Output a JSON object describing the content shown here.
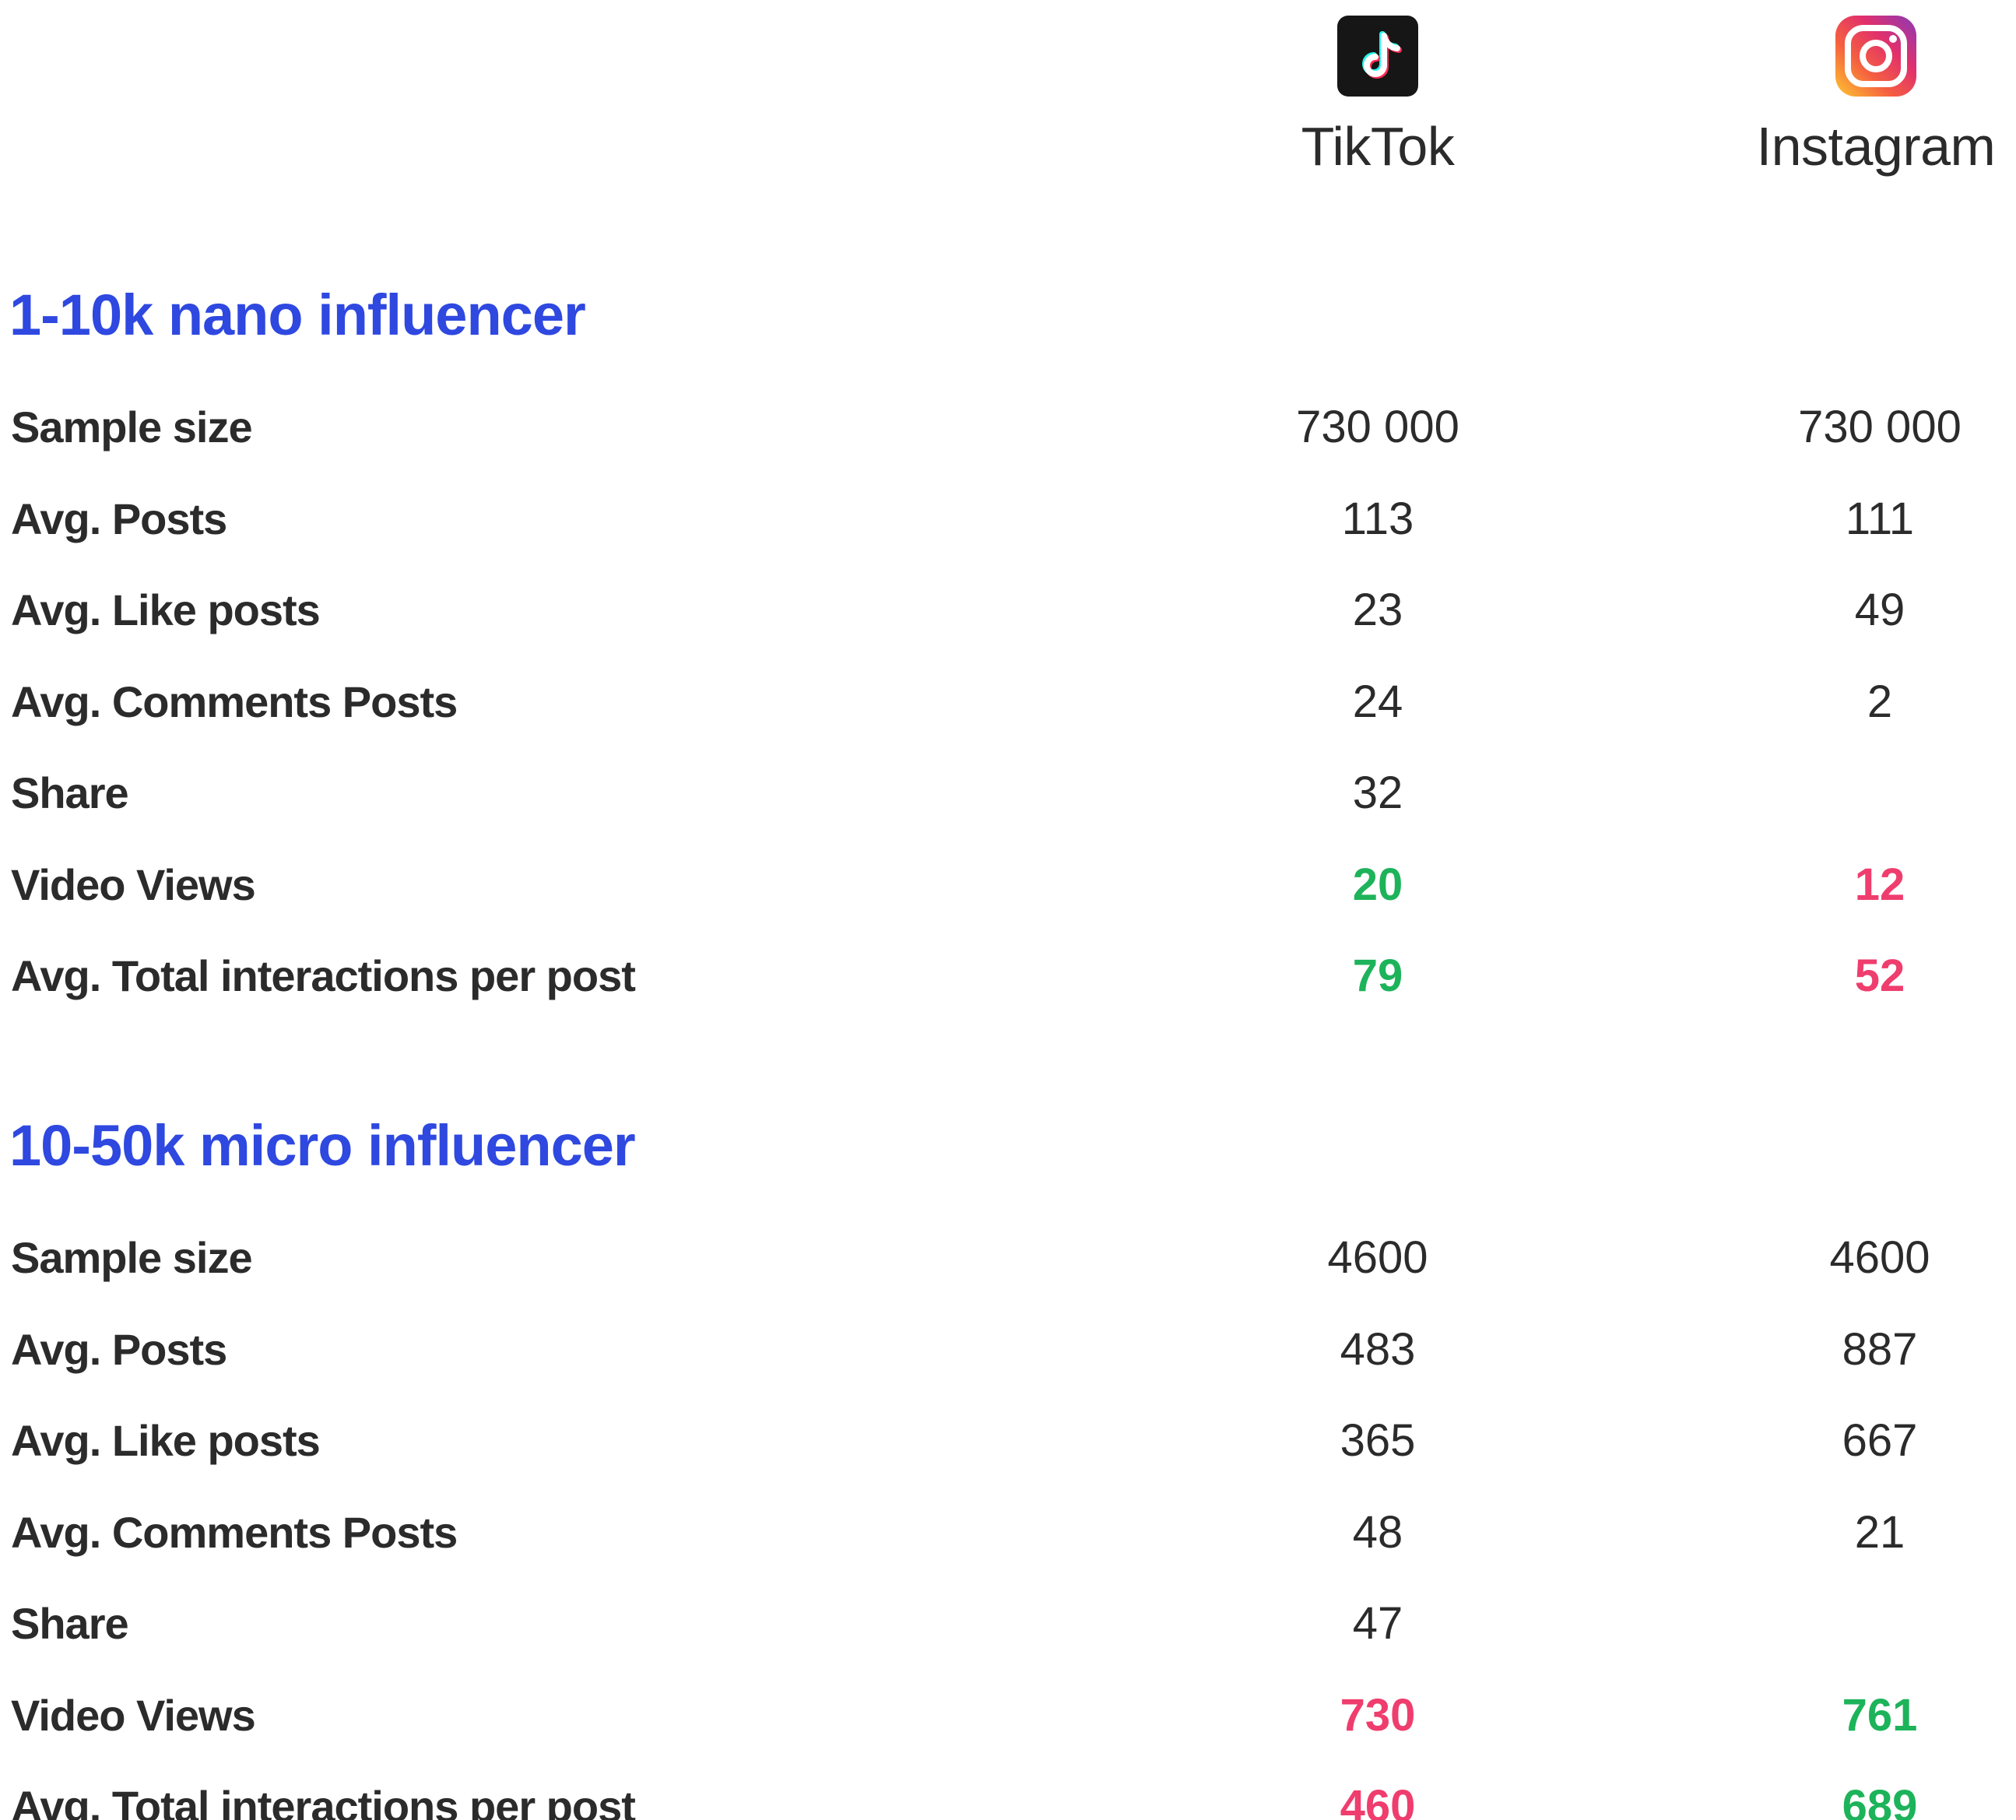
{
  "platforms": {
    "tiktok": {
      "name": "TikTok",
      "icon": "tiktok-logo-icon"
    },
    "instagram": {
      "name": "Instagram",
      "icon": "instagram-logo-icon"
    }
  },
  "colors": {
    "section_title": "#2e48e0",
    "text": "#2b2b2b",
    "positive": "#1db35a",
    "negative": "#ef3d6e"
  },
  "sections": [
    {
      "title": "1-10k nano influencer",
      "rows": [
        {
          "label": "Sample size",
          "tiktok": "730 000",
          "instagram": "730 000"
        },
        {
          "label": "Avg. Posts",
          "tiktok": "113",
          "instagram": "111"
        },
        {
          "label": "Avg. Like posts",
          "tiktok": "23",
          "instagram": "49"
        },
        {
          "label": "Avg. Comments Posts",
          "tiktok": "24",
          "instagram": "2"
        },
        {
          "label": "Share",
          "tiktok": "32",
          "instagram": ""
        },
        {
          "label": "Video Views",
          "tiktok": "20",
          "instagram": "12",
          "tiktok_status": "green",
          "instagram_status": "red"
        },
        {
          "label": "Avg. Total interactions per post",
          "tiktok": "79",
          "instagram": "52",
          "tiktok_status": "green",
          "instagram_status": "red"
        }
      ]
    },
    {
      "title": "10-50k micro influencer",
      "rows": [
        {
          "label": "Sample size",
          "tiktok": "4600",
          "instagram": "4600"
        },
        {
          "label": "Avg. Posts",
          "tiktok": "483",
          "instagram": "887"
        },
        {
          "label": "Avg. Like posts",
          "tiktok": "365",
          "instagram": "667"
        },
        {
          "label": "Avg. Comments Posts",
          "tiktok": "48",
          "instagram": "21"
        },
        {
          "label": "Share",
          "tiktok": "47",
          "instagram": ""
        },
        {
          "label": "Video Views",
          "tiktok": "730",
          "instagram": "761",
          "tiktok_status": "red",
          "instagram_status": "green"
        },
        {
          "label": "Avg. Total interactions per post",
          "tiktok": "460",
          "instagram": "689",
          "tiktok_status": "red",
          "instagram_status": "green"
        }
      ]
    }
  ]
}
